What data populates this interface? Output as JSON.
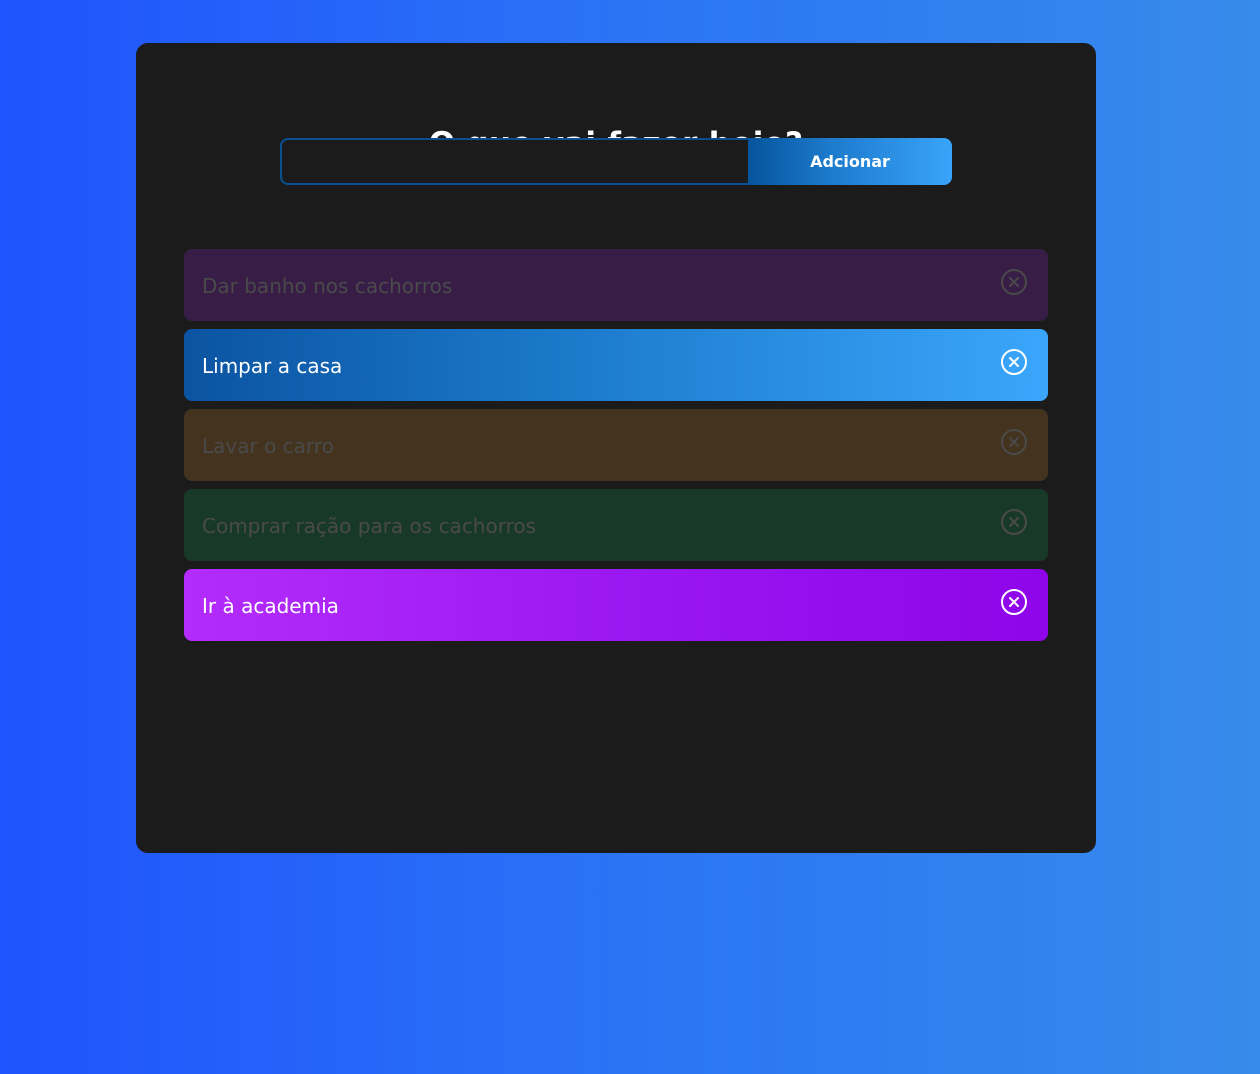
{
  "header": {
    "title": "O que vai fazer hoje?"
  },
  "form": {
    "input_value": "",
    "input_placeholder": "",
    "add_label": "Adcionar"
  },
  "todos": [
    {
      "text": "Dar banho nos cachorros",
      "state": "dimmed",
      "color": "#381e47"
    },
    {
      "text": "Limpar a casa",
      "state": "active",
      "color": "#1c7acb"
    },
    {
      "text": "Lavar o carro",
      "state": "dimmed",
      "color": "#43331f"
    },
    {
      "text": "Comprar ração para os cachorros",
      "state": "dimmed",
      "color": "#193928"
    },
    {
      "text": "Ir à academia",
      "state": "active",
      "color": "#9816f0"
    }
  ],
  "icons": {
    "delete": "close-circle-icon"
  },
  "colors": {
    "background_start": "#1f53fd",
    "background_end": "#378bea",
    "panel": "#1b1b1b",
    "accent": "#085094"
  }
}
